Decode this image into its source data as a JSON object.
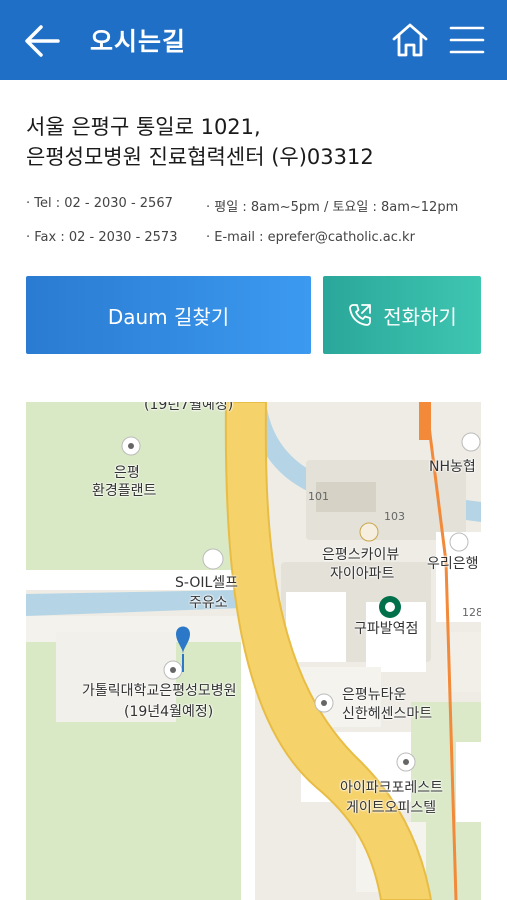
{
  "header": {
    "title": "오시는길",
    "back_icon": "back-arrow-icon",
    "home_icon": "home-icon",
    "menu_icon": "hamburger-menu-icon",
    "background": "#1f6fc6"
  },
  "address": {
    "line1": "서울 은평구 통일로 1021,",
    "line2": "은평성모병원 진료협력센터 (우)03312"
  },
  "info": {
    "tel": "· Tel : 02 - 2030 - 2567",
    "fax": "· Fax : 02 - 2030 - 2573",
    "hours": "· 평일 : 8am~5pm / 토요일 : 8am~12pm",
    "email": "· E-mail : eprefer@catholic.ac.kr"
  },
  "buttons": {
    "daum": "Daum 길찾기",
    "call": "전화하기",
    "call_icon": "phone-icon",
    "daum_color": "#2f86dd",
    "call_color": "#34b6a6"
  },
  "map": {
    "labels": {
      "top_cut": "(19년7월예정)",
      "plant_1": "은평",
      "plant_2": "환경플랜트",
      "soil_1": "S-OIL셀프",
      "soil_2": "주유소",
      "hospital_1": "가톨릭대학교은평성모병원",
      "hospital_2": "(19년4월예정)",
      "sky_1": "은평스카이뷰",
      "sky_2": "자이아파트",
      "starbucks": "구파발역점",
      "nh": "NH농협",
      "woori": "우리은행",
      "newtown_1": "은평뉴타운",
      "newtown_2": "신한헤센스마트",
      "ipark_1": "아이파크포레스트",
      "ipark_2": "게이트오피스텔",
      "bldg_101": "101",
      "bldg_103": "103",
      "bldg_128": "128"
    }
  }
}
